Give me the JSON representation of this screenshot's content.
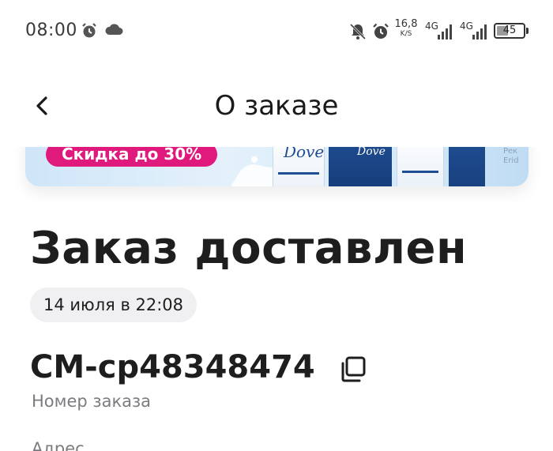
{
  "status_bar": {
    "time": "08:00",
    "net_speed_value": "16,8",
    "net_speed_unit": "K/S",
    "network_1": "4G",
    "network_2": "4G",
    "battery_level": 45,
    "battery_label": "45",
    "icons": [
      "alarm-icon",
      "cloud-icon",
      "mute-bell-icon",
      "alarm-icon",
      "signal-icon",
      "signal-icon",
      "battery-icon"
    ]
  },
  "header": {
    "title": "О заказе",
    "back_icon": "chevron-left-icon"
  },
  "banner": {
    "promo_text": "Скидка до 30%",
    "brand_1": "Dove",
    "brand_2": "Dove",
    "side_text": "Рек Erid"
  },
  "order": {
    "status": "Заказ доставлен",
    "date": "14 июля в 22:08",
    "number": "СМ-ср48348474",
    "number_label": "Номер заказа",
    "copy_icon": "copy-icon",
    "address_label": "Адрес"
  },
  "colors": {
    "promo_pink": "#e0197d",
    "chip_bg": "#f0f0f2",
    "muted_text": "#7c7c80",
    "brand_blue": "#1f4e93"
  }
}
